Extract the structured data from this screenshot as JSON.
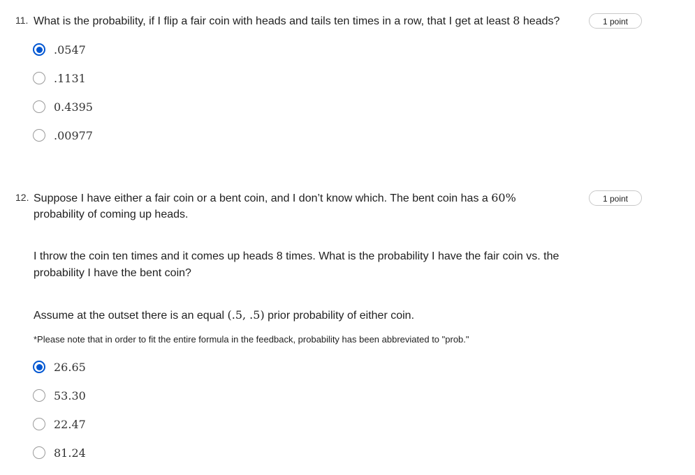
{
  "q11": {
    "number": "11.",
    "text_a": "What is the probability, if I flip a fair coin with heads and tails ten times in a row, that I get at least ",
    "text_math": "8",
    "text_b": " heads?",
    "points": "1 point",
    "options": [
      {
        "label": ".0547",
        "selected": true
      },
      {
        "label": ".1131",
        "selected": false
      },
      {
        "label": "0.4395",
        "selected": false
      },
      {
        "label": ".00977",
        "selected": false
      }
    ]
  },
  "q12": {
    "number": "12.",
    "line1_a": "Suppose I have either a fair coin or a bent coin, and I don’t know which. The bent coin has a ",
    "line1_math": "60%",
    "line2": "probability of coming up heads.",
    "para2_line1": "I throw the coin ten times and it comes up heads 8 times. What is the probability I have the fair coin vs. the",
    "para2_line2": "probability I have the bent coin?",
    "para3_a": "Assume at the outset there is an equal ",
    "para3_math": "(.5, .5)",
    "para3_b": " prior probability of either coin.",
    "note": "*Please note that in order to fit the entire formula in the feedback, probability has been abbreviated to \"prob.\"",
    "points": "1 point",
    "options": [
      {
        "label": "26.65",
        "selected": true
      },
      {
        "label": "53.30",
        "selected": false
      },
      {
        "label": "22.47",
        "selected": false
      },
      {
        "label": "81.24",
        "selected": false
      }
    ]
  },
  "colors": {
    "accent": "#0056d2",
    "radio_border": "#9a9a9a",
    "badge_border": "#c8c8c8"
  }
}
